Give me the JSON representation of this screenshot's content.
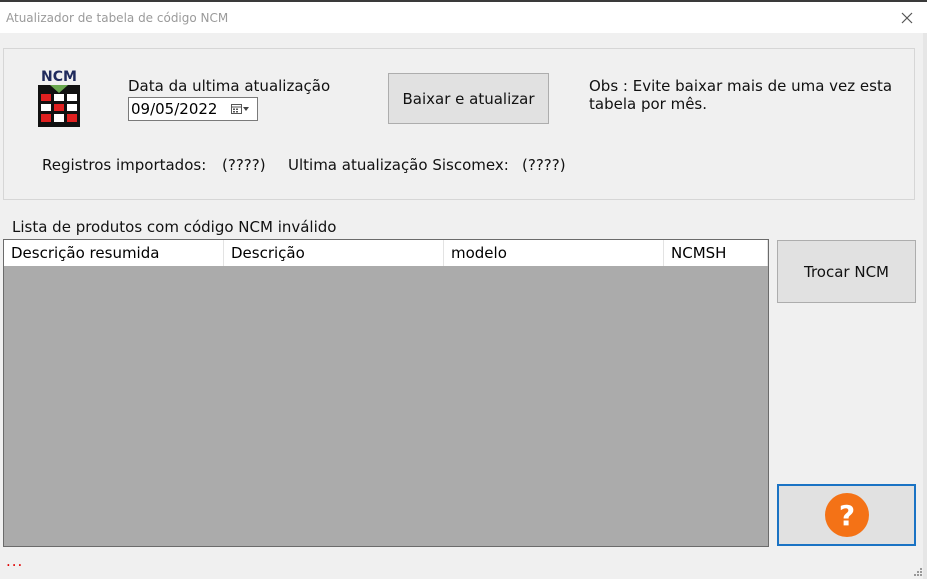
{
  "window": {
    "title": "Atualizador de tabela de código NCM"
  },
  "logo": {
    "text": "NCM",
    "icon": "ncm-table-icon"
  },
  "update": {
    "date_label": "Data da ultima atualização",
    "date_value": "09/05/2022",
    "download_button": "Baixar e atualizar",
    "obs": "Obs : Evite baixar mais de uma vez esta tabela por mês.",
    "records_label": "Registros importados:",
    "records_value": "(????)",
    "siscomex_label": "Ultima atualização Siscomex:",
    "siscomex_value": "(????)"
  },
  "list": {
    "title": "Lista de produtos com código NCM inválido",
    "columns": [
      "Descrição resumida",
      "Descrição",
      "modelo",
      "NCMSH"
    ]
  },
  "actions": {
    "swap_button": "Trocar NCM",
    "help_icon": "question-icon"
  },
  "status": {
    "text": "..."
  },
  "colors": {
    "help_circle": "#f47216",
    "help_border": "#1a73c4",
    "grid_background": "#ababab",
    "status_text": "#e00000"
  }
}
